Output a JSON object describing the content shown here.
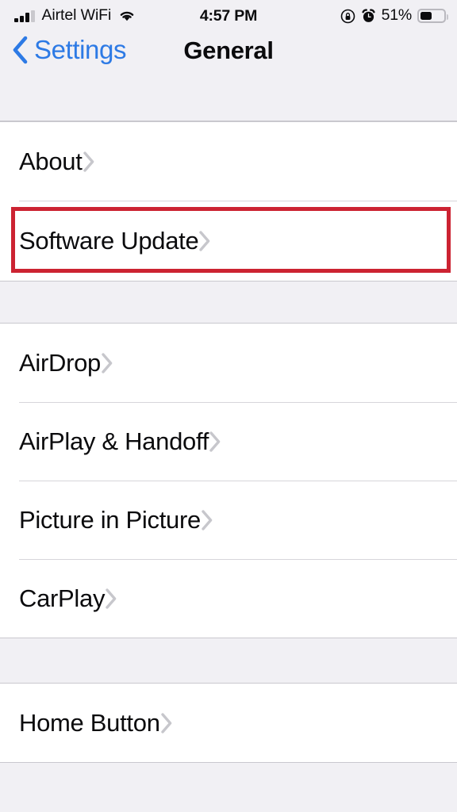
{
  "status_bar": {
    "carrier": "Airtel WiFi",
    "signal_bars_active": 3,
    "signal_bars_total": 4,
    "wifi_icon": "wifi-icon",
    "time": "4:57 PM",
    "rotation_lock_icon": "rotation-lock-icon",
    "alarm_icon": "alarm-clock-icon",
    "battery_percent_label": "51%",
    "battery_level": 51
  },
  "nav": {
    "back_label": "Settings",
    "back_icon": "chevron-left-icon",
    "title": "General"
  },
  "colors": {
    "accent_blue": "#2d7ae5",
    "highlight_red": "#cc2332",
    "background_gray": "#f1f0f4",
    "row_background": "#ffffff",
    "separator": "#d6d5da",
    "chevron_gray": "#c7c7cc",
    "text_primary": "#0b0b0d"
  },
  "groups": [
    {
      "rows": [
        {
          "label": "About",
          "chevron": "chevron-right-icon",
          "highlighted": false
        },
        {
          "label": "Software Update",
          "chevron": "chevron-right-icon",
          "highlighted": true
        }
      ]
    },
    {
      "rows": [
        {
          "label": "AirDrop",
          "chevron": "chevron-right-icon",
          "highlighted": false
        },
        {
          "label": "AirPlay & Handoff",
          "chevron": "chevron-right-icon",
          "highlighted": false
        },
        {
          "label": "Picture in Picture",
          "chevron": "chevron-right-icon",
          "highlighted": false
        },
        {
          "label": "CarPlay",
          "chevron": "chevron-right-icon",
          "highlighted": false
        }
      ]
    },
    {
      "rows": [
        {
          "label": "Home Button",
          "chevron": "chevron-right-icon",
          "highlighted": false
        }
      ]
    }
  ]
}
